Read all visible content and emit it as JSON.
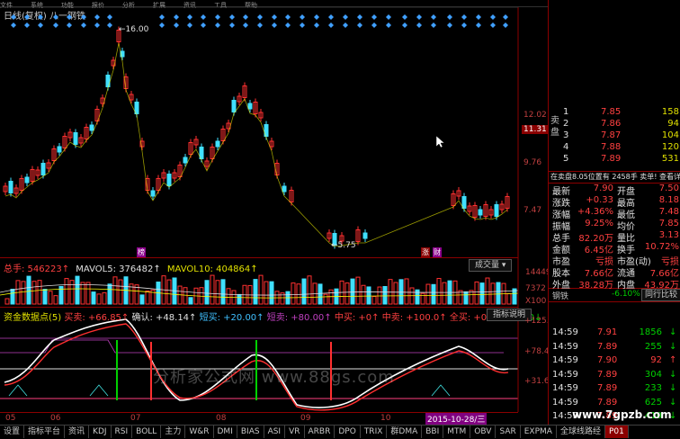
{
  "menu": [
    "文件",
    "系统",
    "功能",
    "报价",
    "分析",
    "扩展",
    "资讯",
    "工具",
    "帮助"
  ],
  "chart_title": "日线(复权)  八一钢铁",
  "price_axis": {
    "labels": [
      "12.02",
      "11.31",
      "9.76",
      "7.47"
    ],
    "current": "11.31"
  },
  "high_mark": "16.00",
  "low_mark": "5.75",
  "events": [
    {
      "label": "榜"
    },
    {
      "label": "涨"
    },
    {
      "label": "财"
    }
  ],
  "volume": {
    "legend_total": "总手: 546223↑",
    "ma5": "MAVOL5: 376482↑",
    "ma10": "MAVOL10: 404864↑",
    "button": "成交量",
    "axis": [
      "14449",
      "7372",
      "X100"
    ]
  },
  "indicator": {
    "legend": [
      "资金数据点(5)",
      "买卖: +66.85↑",
      "确认: +48.14↑",
      "短买: +20.00↑",
      "短卖: +80.00↑",
      "中买: +0↑",
      "中卖: +100.0↑",
      "全买: +0↑",
      "全卖: +0↓"
    ],
    "button": "指标说明",
    "axis": [
      "+125.3",
      "+78.48",
      "+31.67"
    ]
  },
  "x_axis": [
    "05",
    "06",
    "07",
    "08",
    "09",
    "10"
  ],
  "date_badge": "2015-10-28/三",
  "tabs": [
    "设置",
    "指标平台",
    "资讯",
    "KDJ",
    "RSI",
    "BOLL",
    "主力",
    "W&R",
    "DMI",
    "BIAS",
    "ASI",
    "VR",
    "ARBR",
    "DPO",
    "TRIX",
    "群DMA",
    "BBI",
    "MTM",
    "OBV",
    "SAR",
    "EXPMA",
    "全球线路经",
    "P01"
  ],
  "watermark": "分析家公式网 www.88gs.com",
  "site": "www.7gpzb.com",
  "quote": {
    "sell": [
      {
        "n": "5",
        "p": "7.89",
        "v": "531"
      },
      {
        "n": "4",
        "p": "7.88",
        "v": "120"
      },
      {
        "n": "3",
        "p": "7.87",
        "v": "104"
      },
      {
        "n": "2",
        "p": "7.86",
        "v": "94"
      },
      {
        "n": "1",
        "p": "7.85",
        "v": "158"
      }
    ],
    "sell_label": "卖盘",
    "info_line": "在卖盘8.05位置有  2458手  卖单!  查看详细",
    "stats": [
      {
        "k1": "最新",
        "v1": "7.90",
        "k2": "开盘",
        "v2": "7.50"
      },
      {
        "k1": "涨跌",
        "v1": "+0.33",
        "k2": "最高",
        "v2": "8.18"
      },
      {
        "k1": "涨幅",
        "v1": "+4.36%",
        "k2": "最低",
        "v2": "7.48"
      },
      {
        "k1": "振幅",
        "v1": "9.25%",
        "k2": "均价",
        "v2": "7.85"
      },
      {
        "k1": "总手",
        "v1": "82.20万",
        "k2": "量比",
        "v2": "3.13"
      },
      {
        "k1": "金额",
        "v1": "6.45亿",
        "k2": "换手",
        "v2": "10.72%"
      },
      {
        "k1": "市盈",
        "v1": "亏损",
        "k2": "市盈(动)",
        "v2": "亏损"
      },
      {
        "k1": "股本",
        "v1": "7.66亿",
        "k2": "流通",
        "v2": "7.66亿"
      },
      {
        "k1": "外盘",
        "v1": "38.28万",
        "k2": "内盘",
        "v2": "43.92万"
      }
    ],
    "sector": {
      "name": "钢铁",
      "chg": "-6.10%",
      "btn": "同行比较"
    },
    "ticks": [
      {
        "t": "14:59",
        "p": "7.91",
        "v": "1856",
        "d": "down"
      },
      {
        "t": "14:59",
        "p": "7.89",
        "v": "255",
        "d": "down"
      },
      {
        "t": "14:59",
        "p": "7.90",
        "v": "92",
        "d": "up"
      },
      {
        "t": "14:59",
        "p": "7.89",
        "v": "304",
        "d": "down"
      },
      {
        "t": "14:59",
        "p": "7.89",
        "v": "233",
        "d": "down"
      },
      {
        "t": "14:59",
        "p": "7.89",
        "v": "625",
        "d": "down"
      },
      {
        "t": "14:59",
        "p": "7.89",
        "v": "410",
        "d": "down"
      }
    ]
  },
  "colors": {
    "up": "#ff4040",
    "down": "#00d000",
    "candle_up": "#ff3030",
    "candle_down": "#40e0ff",
    "ma": "#ffff00",
    "border": "#8b0000"
  }
}
